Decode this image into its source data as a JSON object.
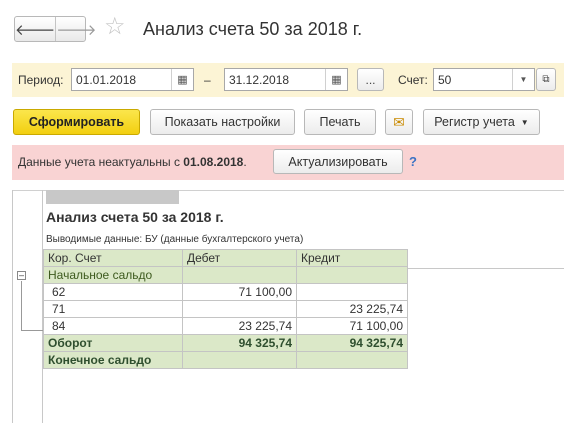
{
  "header": {
    "back_icon": "arrow-left-icon",
    "forward_icon": "arrow-right-icon",
    "favorite_icon": "star-icon",
    "title": "Анализ счета 50 за 2018 г."
  },
  "toolbar": {
    "period_label": "Период:",
    "date_from": "01.01.2018",
    "dash": "–",
    "date_to": "31.12.2018",
    "more_label": "...",
    "account_label": "Счет:",
    "account_value": "50"
  },
  "actions": {
    "generate": "Сформировать",
    "show_settings": "Показать настройки",
    "print": "Печать",
    "email_icon": "envelope-icon",
    "register": "Регистр учета"
  },
  "warning": {
    "text_prefix": "Данные учета неактуальны с ",
    "date": "01.08.2018",
    "text_suffix": ".",
    "update_button": "Актуализировать",
    "help": "?"
  },
  "report": {
    "title": "Анализ счета 50 за 2018 г.",
    "subtitle": "Выводимые данные:  БУ (данные бухгалтерского учета)",
    "columns": [
      "Кор. Счет",
      "Дебет",
      "Кредит"
    ],
    "opening_balance": "Начальное сальдо",
    "rows": [
      {
        "account": "62",
        "debit": "71 100,00",
        "credit": ""
      },
      {
        "account": "71",
        "debit": "",
        "credit": "23 225,74"
      },
      {
        "account": "84",
        "debit": "23 225,74",
        "credit": "71 100,00"
      }
    ],
    "turnover": {
      "label": "Оборот",
      "debit": "94 325,74",
      "credit": "94 325,74"
    },
    "closing_balance": "Конечное сальдо",
    "collapse_symbol": "–"
  }
}
